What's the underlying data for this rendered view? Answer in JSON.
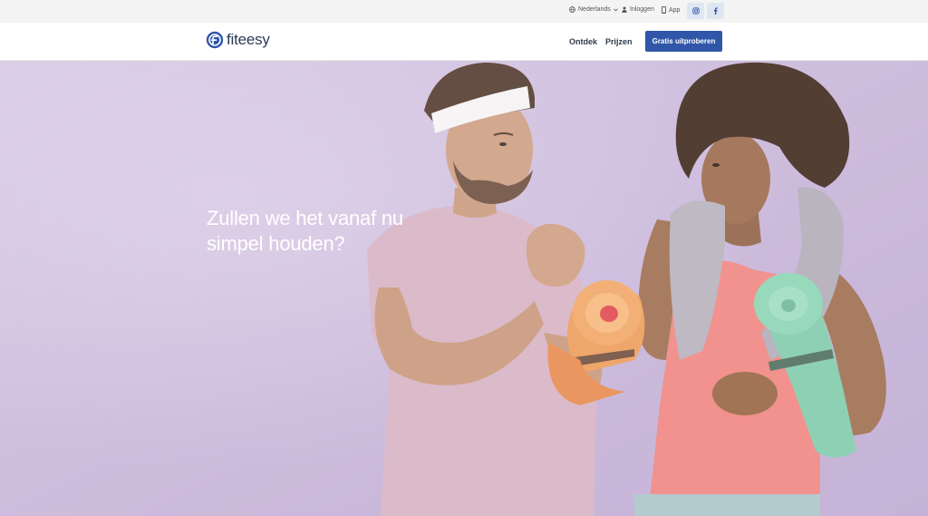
{
  "topbar": {
    "language": "Nederlands",
    "login": "Inloggen",
    "app": "App",
    "social": {
      "instagram_icon": "instagram-icon",
      "facebook_icon": "facebook-icon"
    }
  },
  "header": {
    "logo_text": "fiteesy",
    "nav": [
      {
        "label": "Ontdek"
      },
      {
        "label": "Prijzen"
      }
    ],
    "cta_label": "Gratis uitproberen"
  },
  "hero": {
    "headline_line1": "Zullen we het vanaf nu",
    "headline_line2": "simpel houden?",
    "image_alt": "Man and woman with yoga mats shaking hands"
  },
  "colors": {
    "brand_blue": "#2f56a8",
    "hero_background": "#c9b7d9",
    "topbar_background": "#f4f4f4"
  }
}
